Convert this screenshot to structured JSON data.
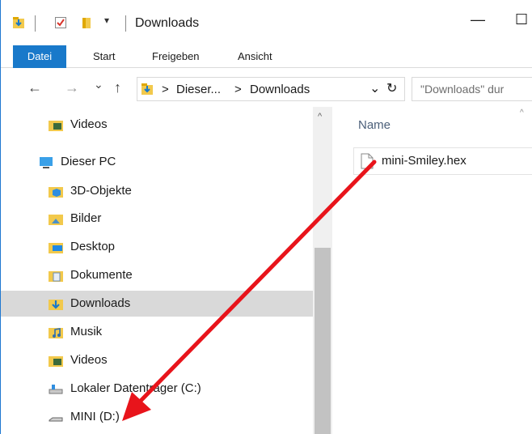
{
  "window": {
    "title": "Downloads",
    "minimize_glyph": "—",
    "maximize_glyph": "☐"
  },
  "quick_access": {
    "dropdown_glyph": "▾"
  },
  "ribbon": {
    "tabs": [
      {
        "label": "Datei"
      },
      {
        "label": "Start"
      },
      {
        "label": "Freigeben"
      },
      {
        "label": "Ansicht"
      }
    ]
  },
  "addressbar": {
    "back_glyph": "←",
    "forward_glyph": "→",
    "recent_glyph": "⌄",
    "up_glyph": "↑",
    "chevron_1": ">",
    "crumb_1": "Dieser...",
    "chevron_2": ">",
    "crumb_2": "Downloads",
    "dropdown_glyph": "⌄",
    "refresh_glyph": "↻",
    "search_placeholder": "\"Downloads\" dur"
  },
  "navpane": {
    "items": [
      {
        "label": "Videos",
        "icon": "videos-folder-icon"
      },
      {
        "label": "Dieser PC",
        "icon": "this-pc-icon"
      },
      {
        "label": "3D-Objekte",
        "icon": "3d-objects-folder-icon"
      },
      {
        "label": "Bilder",
        "icon": "pictures-folder-icon"
      },
      {
        "label": "Desktop",
        "icon": "desktop-folder-icon"
      },
      {
        "label": "Dokumente",
        "icon": "documents-folder-icon"
      },
      {
        "label": "Downloads",
        "icon": "downloads-folder-icon",
        "selected": true
      },
      {
        "label": "Musik",
        "icon": "music-folder-icon"
      },
      {
        "label": "Videos",
        "icon": "videos-folder-icon"
      },
      {
        "label": "Lokaler Datenträger (C:)",
        "icon": "local-disk-icon"
      },
      {
        "label": "MINI (D:)",
        "icon": "removable-drive-icon"
      }
    ],
    "scroll_up_glyph": "^"
  },
  "content": {
    "column_header": "Name",
    "sort_glyph": "^",
    "files": [
      {
        "name": "mini-Smiley.hex",
        "icon": "file-icon"
      }
    ]
  },
  "colors": {
    "accent": "#1979ca",
    "selection": "#d9d9d9",
    "arrow": "#e8141b",
    "folder": "#f2c94c"
  }
}
